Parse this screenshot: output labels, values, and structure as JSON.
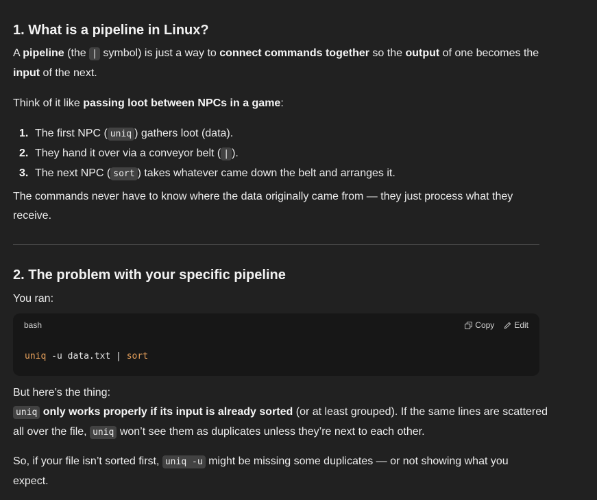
{
  "section1": {
    "heading": "1. What is a pipeline in Linux?",
    "p1": {
      "t1": "A ",
      "b1": "pipeline",
      "t2": " (the ",
      "code1": "|",
      "t3": " symbol) is just a way to ",
      "b2": "connect commands together",
      "t4": " so the ",
      "b3": "output",
      "t5": " of one becomes the",
      "b4": "input",
      "t6": " of the next."
    },
    "p2": {
      "t1": "Think of it like ",
      "b1": "passing loot between NPCs in a game",
      "t2": ":"
    },
    "list": [
      {
        "num": "1.",
        "t1": "The first NPC (",
        "code": "uniq",
        "t2": ") gathers loot (data)."
      },
      {
        "num": "2.",
        "t1": "They hand it over via a conveyor belt (",
        "code": "|",
        "t2": ")."
      },
      {
        "num": "3.",
        "t1": "The next NPC (",
        "code": "sort",
        "t2": ") takes whatever came down the belt and arranges it."
      }
    ],
    "p3_line1": "The commands never have to know where the data originally came from — they just process what they",
    "p3_line2": "receive."
  },
  "section2": {
    "heading": "2. The problem with your specific pipeline",
    "you_ran": "You ran:",
    "codeblock": {
      "lang": "bash",
      "copy_label": "Copy",
      "edit_label": "Edit",
      "tok1": "uniq",
      "tok2": " -u data.txt | ",
      "tok3": "sort"
    },
    "p1": "But here’s the thing:",
    "p2": {
      "code1": "uniq",
      "b1": " only works properly if its input is already sorted",
      "t1": " (or at least grouped). If the same lines are scattered",
      "t2": "all over the file, ",
      "code2": "uniq",
      "t3": " won’t see them as duplicates unless they’re next to each other."
    },
    "p3": {
      "t1": "So, if your file isn’t sorted first, ",
      "code1": "uniq -u",
      "t2": " might be missing some duplicates — or not showing what you",
      "t3": "expect."
    }
  }
}
